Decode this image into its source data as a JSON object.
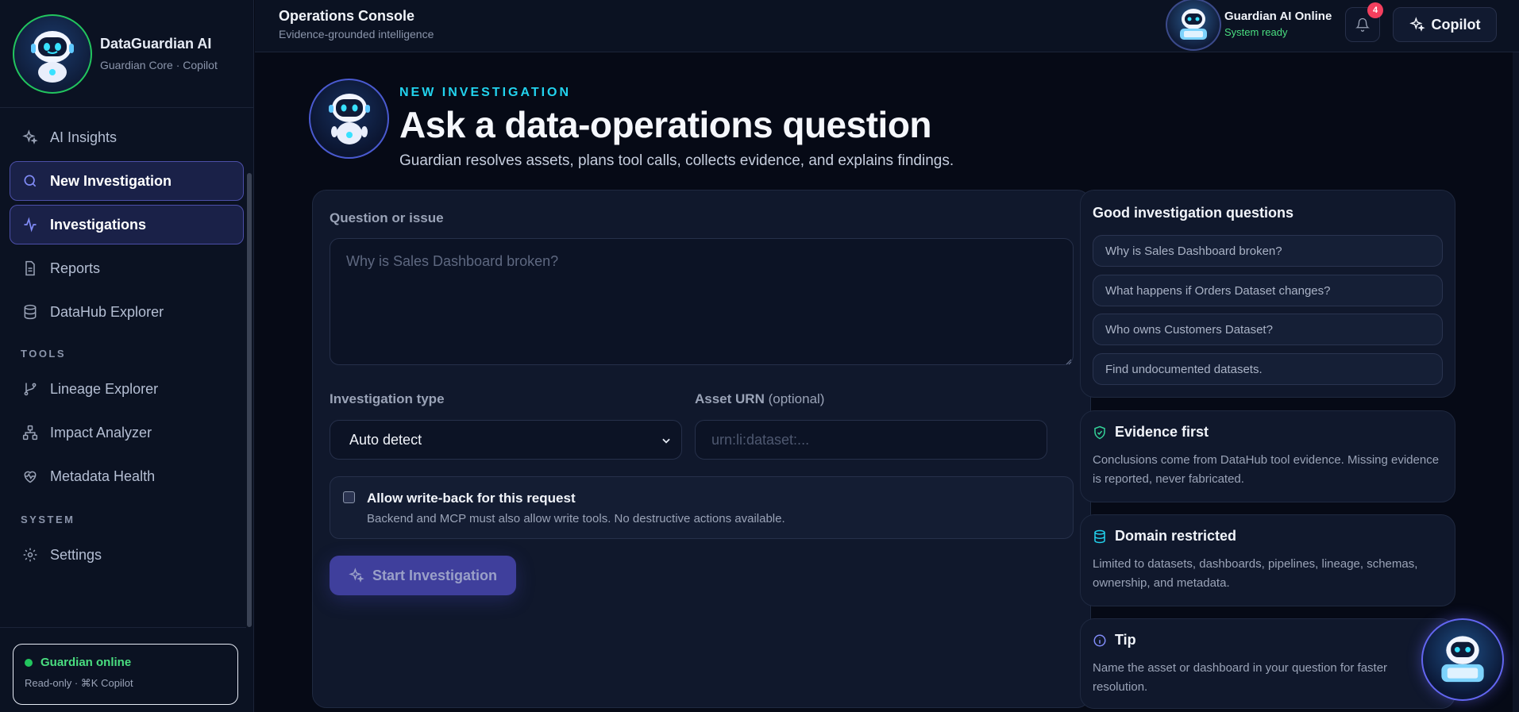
{
  "brand": {
    "name": "DataGuardian AI",
    "subtitle": "Guardian Core · Copilot"
  },
  "sidebar": {
    "items": [
      {
        "label": "AI Insights",
        "icon": "sparkles-icon"
      },
      {
        "label": "New Investigation",
        "icon": "search-icon",
        "active": true
      },
      {
        "label": "Investigations",
        "icon": "activity-icon",
        "active": true
      },
      {
        "label": "Reports",
        "icon": "file-text-icon"
      },
      {
        "label": "DataHub Explorer",
        "icon": "database-icon"
      }
    ],
    "tools_heading": "TOOLS",
    "tools": [
      {
        "label": "Lineage Explorer",
        "icon": "git-branch-icon"
      },
      {
        "label": "Impact Analyzer",
        "icon": "network-icon"
      },
      {
        "label": "Metadata Health",
        "icon": "heart-pulse-icon"
      }
    ],
    "system_heading": "SYSTEM",
    "system": [
      {
        "label": "Settings",
        "icon": "gear-icon"
      }
    ],
    "status": {
      "title": "Guardian online",
      "subtitle": "Read-only · ⌘K Copilot"
    }
  },
  "topbar": {
    "title": "Operations Console",
    "subtitle": "Evidence-grounded intelligence",
    "ai_name": "Guardian AI Online",
    "ai_status": "System ready",
    "notification_count": "4",
    "copilot_label": "Copilot"
  },
  "hero": {
    "eyebrow": "NEW INVESTIGATION",
    "title": "Ask a data-operations question",
    "subtitle": "Guardian resolves assets, plans tool calls, collects evidence, and explains findings."
  },
  "form": {
    "question_label": "Question or issue",
    "question_value": "",
    "question_placeholder": "Why is Sales Dashboard broken?",
    "type_label": "Investigation type",
    "type_selected": "Auto detect",
    "urn_label": "Asset URN",
    "urn_optional": "(optional)",
    "urn_value": "",
    "urn_placeholder": "urn:li:dataset:...",
    "writeback_checked": false,
    "writeback_title": "Allow write-back for this request",
    "writeback_sub": "Backend and MCP must also allow write tools. No destructive actions available.",
    "start_label": "Start Investigation"
  },
  "suggestions": {
    "title": "Good investigation questions",
    "items": [
      "Why is Sales Dashboard broken?",
      "What happens if Orders Dataset changes?",
      "Who owns Customers Dataset?",
      "Find undocumented datasets."
    ]
  },
  "info_cards": [
    {
      "title": "Evidence first",
      "icon": "shield-check-icon",
      "body": "Conclusions come from DataHub tool evidence. Missing evidence is reported, never fabricated."
    },
    {
      "title": "Domain restricted",
      "icon": "database-icon",
      "body": "Limited to datasets, dashboards, pipelines, lineage, schemas, ownership, and metadata."
    },
    {
      "title": "Tip",
      "icon": "info-icon",
      "body": "Name the asset or dashboard in your question for faster resolution."
    }
  ],
  "colors": {
    "accent": "#6366f1",
    "cyan": "#22d3ee",
    "online": "#22c55e",
    "badge": "#f43f5e",
    "background": "#060a16"
  }
}
